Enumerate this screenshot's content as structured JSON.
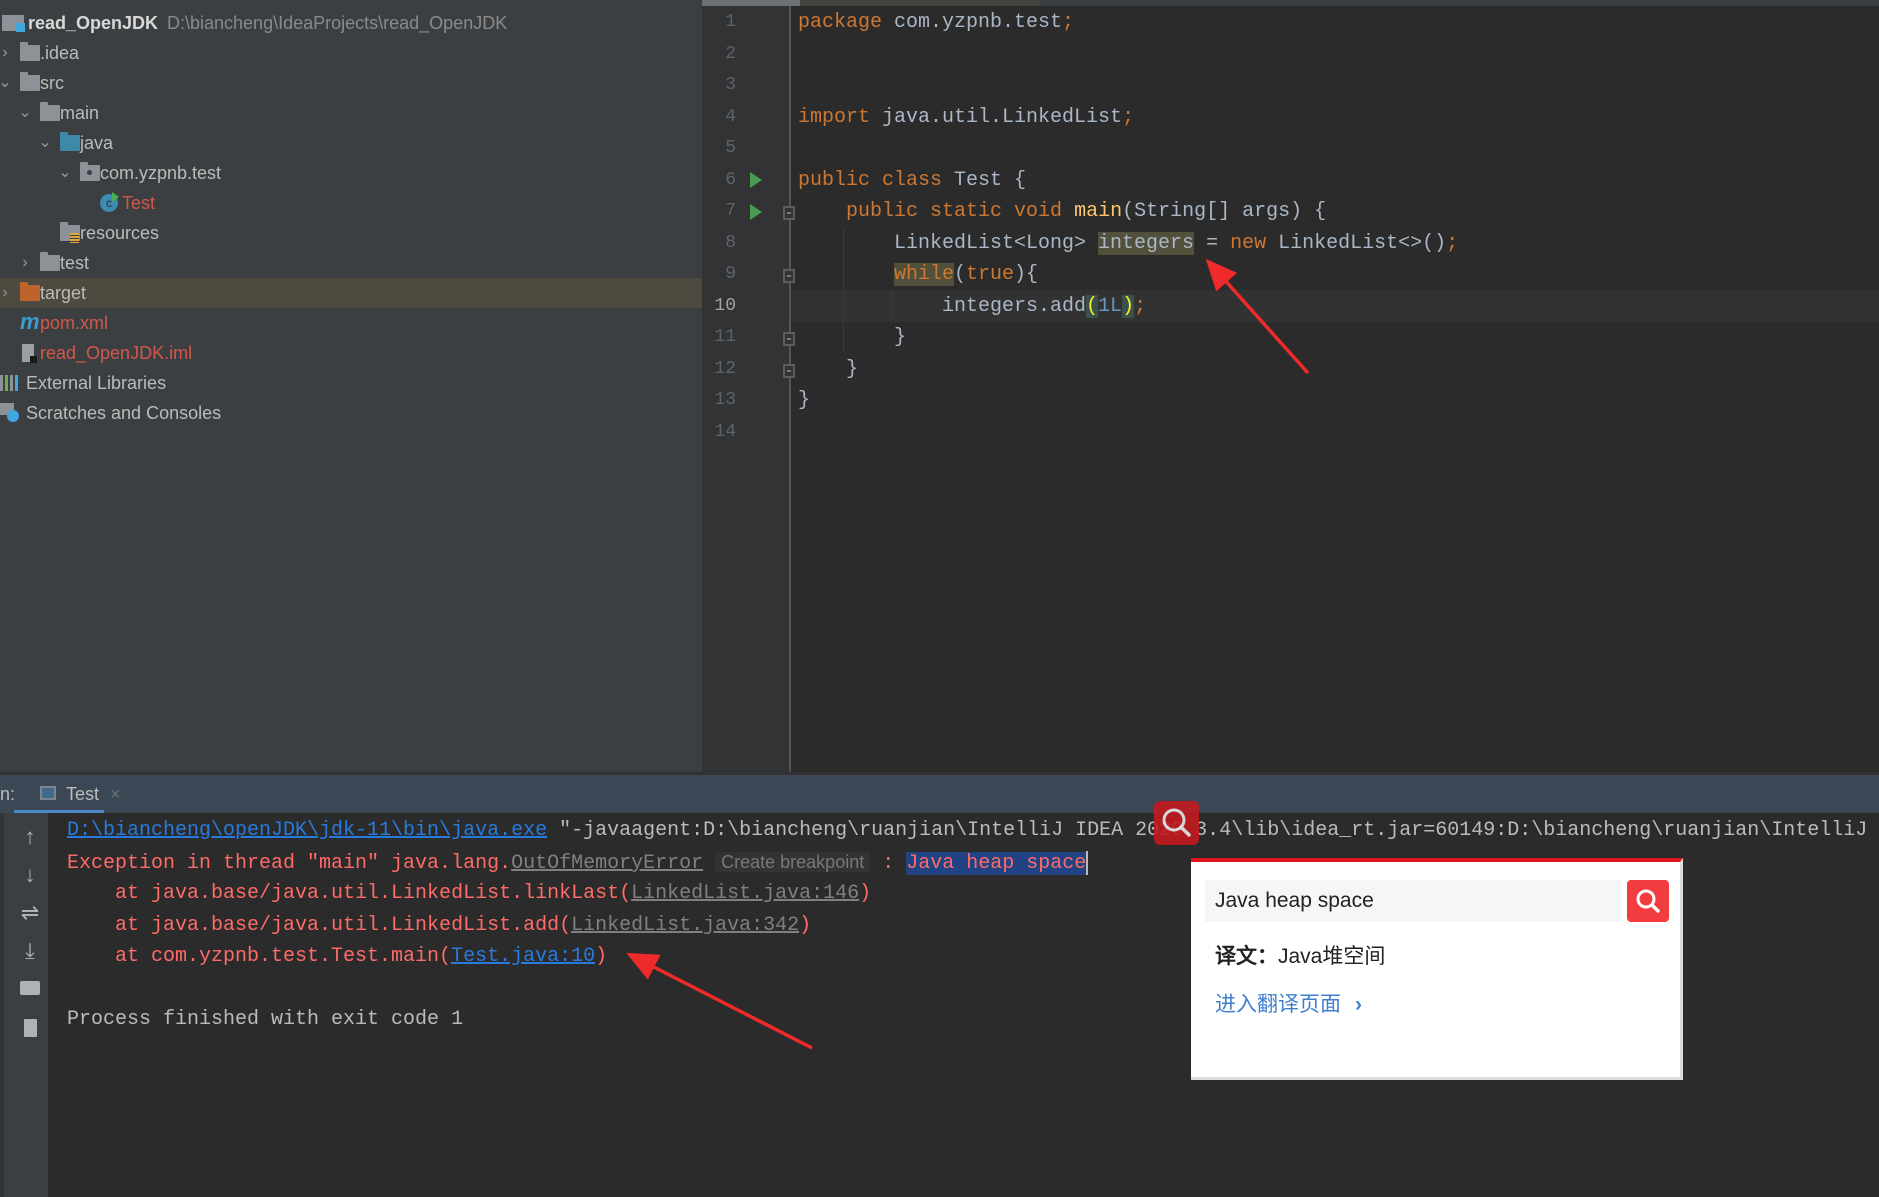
{
  "project": {
    "root": {
      "name": "read_OpenJDK",
      "path": "D:\\biancheng\\IdeaProjects\\read_OpenJDK"
    },
    "items": [
      {
        "label": ".idea",
        "chevron": "right",
        "icon": "folder-icon"
      },
      {
        "label": "src",
        "chevron": "down",
        "icon": "folder-icon"
      },
      {
        "label": "main",
        "chevron": "down",
        "icon": "folder-icon"
      },
      {
        "label": "java",
        "chevron": "down",
        "icon": "source-folder-icon"
      },
      {
        "label": "com.yzpnb.test",
        "chevron": "down",
        "icon": "package-icon"
      },
      {
        "label": "Test",
        "icon": "java-class-icon"
      },
      {
        "label": "resources",
        "icon": "resources-folder-icon"
      },
      {
        "label": "test",
        "chevron": "right",
        "icon": "folder-icon"
      },
      {
        "label": "target",
        "chevron": "right",
        "icon": "excluded-folder-icon",
        "selected": true
      },
      {
        "label": "pom.xml",
        "icon": "maven-icon"
      },
      {
        "label": "read_OpenJDK.iml",
        "icon": "iml-file-icon"
      },
      {
        "label": "External Libraries",
        "icon": "libraries-icon"
      },
      {
        "label": "Scratches and Consoles",
        "icon": "scratches-icon"
      }
    ]
  },
  "editor": {
    "current_line": 10,
    "line_numbers": [
      "1",
      "2",
      "3",
      "4",
      "5",
      "6",
      "7",
      "8",
      "9",
      "10",
      "11",
      "12",
      "13",
      "14"
    ],
    "code": {
      "l1_kw": "package",
      "l1_rest": " com.yzpnb.test",
      "l1_semi": ";",
      "l4_kw": "import",
      "l4_rest": " java.util.LinkedList",
      "l4_semi": ";",
      "l6_kw": "public class",
      "l6_rest": " Test {",
      "l7_kw": "public static void",
      "l7_fn": "main",
      "l7_rest": "(String[] args) {",
      "l8_type": "LinkedList<Long> ",
      "l8_var": "integers",
      "l8_eq": " = ",
      "l8_new": "new",
      "l8_rest": " LinkedList<>()",
      "l8_semi": ";",
      "l9_kw": "while",
      "l9_p1": "(",
      "l9_true": "true",
      "l9_p2": "){",
      "l10_pre": "integers.add",
      "l10_open": "(",
      "l10_num": "1L",
      "l10_close": ")",
      "l10_semi": ";",
      "l11": "}",
      "l12": "}",
      "l13": "}"
    }
  },
  "run_panel": {
    "label": "n:",
    "tab_label": "Test",
    "tab_close": "×",
    "toolbar": [
      "up-arrow-icon",
      "down-arrow-icon",
      "soft-wrap-icon",
      "scroll-to-end-icon",
      "print-icon",
      "trash-icon"
    ],
    "console": {
      "line1_link": "D:\\biancheng\\openJDK\\jdk-11\\bin\\java.exe",
      "line1_rest": " \"-javaagent:D:\\biancheng\\ruanjian\\IntelliJ IDEA 2020.3.4\\lib\\idea_rt.jar=60149:D:\\biancheng\\ruanjian\\IntelliJ",
      "line2_pre": "Exception in thread \"main\" java.lang.",
      "line2_link": "OutOfMemoryError",
      "line2_inlay": "Create breakpoint",
      "line2_colon": " : ",
      "line2_selected": "Java heap space",
      "line3_pre": "    at java.base/java.util.LinkedList.linkLast(",
      "line3_link": "LinkedList.java:146",
      "line3_post": ")",
      "line4_pre": "    at java.base/java.util.LinkedList.add(",
      "line4_link": "LinkedList.java:342",
      "line4_post": ")",
      "line5_pre": "    at com.yzpnb.test.Test.main(",
      "line5_link": "Test.java:10",
      "line5_post": ")",
      "line7": "Process finished with exit code 1"
    }
  },
  "translation_popup": {
    "query": "Java heap space",
    "result_label": "译文：",
    "result_text": "Java堆空间",
    "link_label": "进入翻译页面",
    "accent_color": "#e0141c",
    "button_color": "#f23c3f"
  },
  "annotations": {
    "arrow_color": "#ee2a2a"
  }
}
